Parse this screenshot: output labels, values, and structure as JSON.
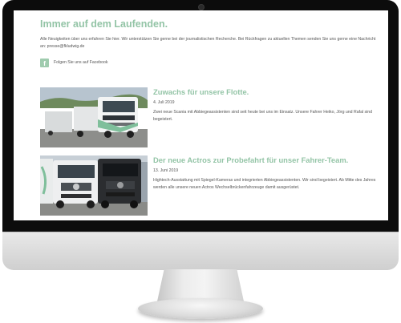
{
  "page": {
    "title": "Immer auf dem Laufenden.",
    "intro": "Alle Neuigkeiten über uns erfahren Sie hier. Wir unterstützen Sie gerne bei der journalistischen Recherche. Bei Rückfragen zu aktuellen Themen senden Sie uns gerne eine Nachricht an: presse@fkludwig.de",
    "facebook_icon_glyph": "f",
    "facebook_label": "Folgen Sie uns auf Facebook"
  },
  "articles": [
    {
      "title": "Zuwachs für unsere Flotte.",
      "date": "4. Juli 2019",
      "text": "Zwei neue Scania mit Abbiegeassistenten sind seit heute bei uns im Einsatz. Unsere Fahrer Heiko, Jörg und Rafal sind begeistert."
    },
    {
      "title": "Der neue Actros zur Probefahrt für unser Fahrer-Team.",
      "date": "13. Juni 2019",
      "text": "Hightech-Ausstattung mit Spiegel-Kameras und integrierten Abbiegeassistenten. Wir sind begeistert. Ab Mitte des Jahres werden alle unsere neuen Actros Wechselbrückenfahrzeuge damit ausgerüstet."
    }
  ],
  "colors": {
    "accent": "#93c4a6",
    "text": "#555555",
    "bezel": "#0c0c0c",
    "chin": "#dcdcdc"
  },
  "icons": [
    "facebook-icon",
    "camera-dot-icon"
  ]
}
